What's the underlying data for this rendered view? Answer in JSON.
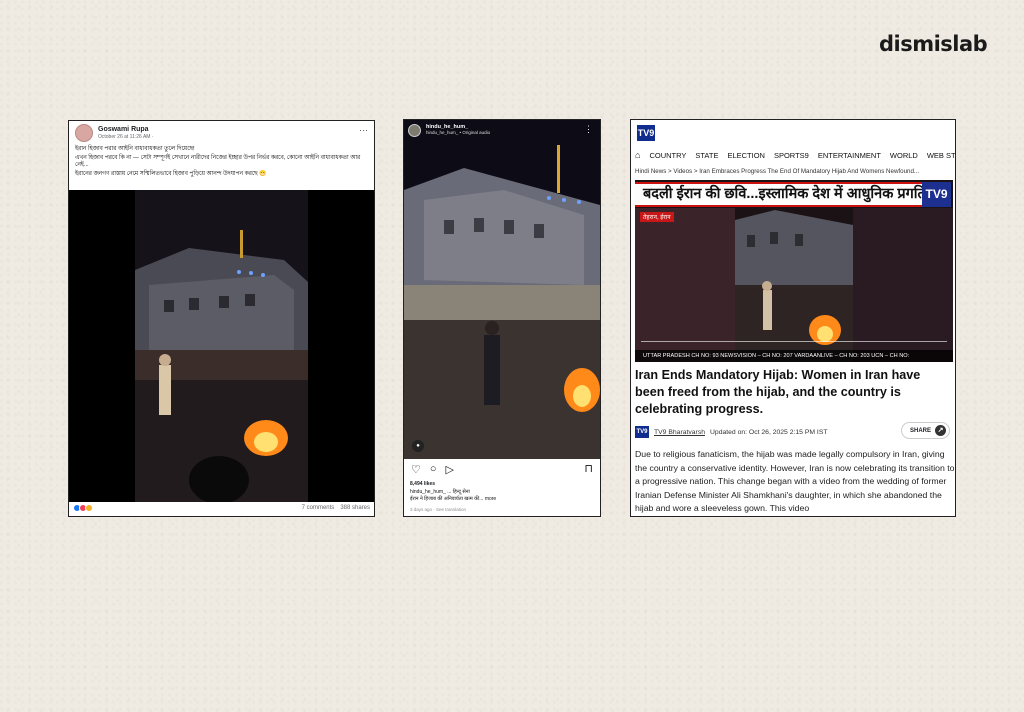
{
  "brand": "dismislab",
  "facebook": {
    "author": "Goswami Rupa",
    "date": "October 26 at 11:26 AM ·",
    "menu_icon": "more-horizontal-icon",
    "text_line1": "ইরান হিজাব পরার আইনি বাধ্যবাধকতা তুলে দিয়েছে!",
    "text_line2": "এখন হিজাব পরবে কি না — সেটা সম্পূর্ণই সেখানে নারীদের নিজের ইচ্ছার উপর নির্ভর করবে, কোনো আইনি বাধ্যবাধকতা আর নেই...",
    "text_line3": "ইরানের জনগণ রাস্তায় নেমে সম্মিলিতভাবে হিজাব পুড়িয়ে আনন্দ উদযাপন করছে 😁",
    "comments": "7 comments",
    "shares": "388 shares"
  },
  "instagram": {
    "username": "hindu_he_hum_",
    "audio": "hindu_he_hum_ • Original audio",
    "likes": "8,494 likes",
    "caption_line1": "hindu_he_hum_ ... हिन्दू सेना",
    "caption_line2": "ईरान ने हिजाब की अनिवार्यता खत्म की... more",
    "time": "3 days ago",
    "see_translation": "See translation"
  },
  "tv9": {
    "logo": "TV9",
    "nav": [
      "COUNTRY",
      "STATE",
      "ELECTION",
      "SPORTS9",
      "ENTERTAINMENT",
      "WORLD",
      "WEB STORY"
    ],
    "breadcrumb": "Hindi News > Videos > Iran Embraces Progress The End Of Mandatory Hijab And Womens Newfound...",
    "banner": "बदली ईरान की छवि...इस्लामिक देश में आधुनिक प्रगति",
    "location_tag": "तेहरान, ईरान",
    "ticker": "UTTAR PRADESH  CH NO: 93   NEWSVISION – CH NO: 207   VARDAANLIVE – CH NO: 203   UCN – CH NO:",
    "headline": "Iran Ends Mandatory Hijab: Women in Iran have been freed from the hijab, and the country is celebrating progress.",
    "source": "TV9 Bharatvarsh",
    "updated": "Updated on: Oct 26, 2025 2:15 PM IST",
    "share": "SHARE",
    "body": "Due to religious fanaticism, the hijab was made legally compulsory in Iran, giving the country a conservative identity. However, Iran is now celebrating its transition to a progressive nation. This change began with a video from the wedding of former Iranian Defense Minister Ali Shamkhani's daughter, in which she abandoned the hijab and wore a sleeveless gown. This video"
  }
}
